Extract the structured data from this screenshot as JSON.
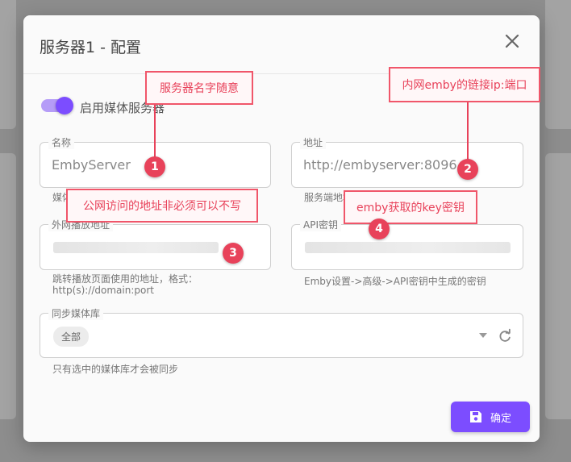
{
  "dialog": {
    "title": "服务器1 - 配置",
    "close_icon": "close-icon"
  },
  "enable_toggle": {
    "label": "启用媒体服务器",
    "checked": true
  },
  "fields": {
    "name": {
      "legend": "名称",
      "value": "EmbyServer",
      "hint": "媒体服务器的别名"
    },
    "address": {
      "legend": "地址",
      "value": "http://embyserver:8096",
      "hint": "服务端地址，格式：http(s)://ip:port"
    },
    "external_address": {
      "legend": "外网播放地址",
      "hint": "跳转播放页面使用的地址，格式：http(s)://domain:port"
    },
    "api_key": {
      "legend": "API密钥",
      "hint": "Emby设置->高级->API密钥中生成的密钥"
    },
    "libraries": {
      "legend": "同步媒体库",
      "chip": "全部",
      "hint": "只有选中的媒体库才会被同步"
    }
  },
  "confirm_button": {
    "label": "确定",
    "icon": "save-icon"
  },
  "annotations": [
    {
      "number": "1",
      "text": "服务器名字随意"
    },
    {
      "number": "2",
      "text": "内网emby的链接ip:端口"
    },
    {
      "number": "3",
      "text": "公网访问的地址非必须可以不写"
    },
    {
      "number": "4",
      "text": "emby获取的key密钥"
    }
  ],
  "colors": {
    "accent": "#7c4dff",
    "annotation": "#e8425a"
  }
}
